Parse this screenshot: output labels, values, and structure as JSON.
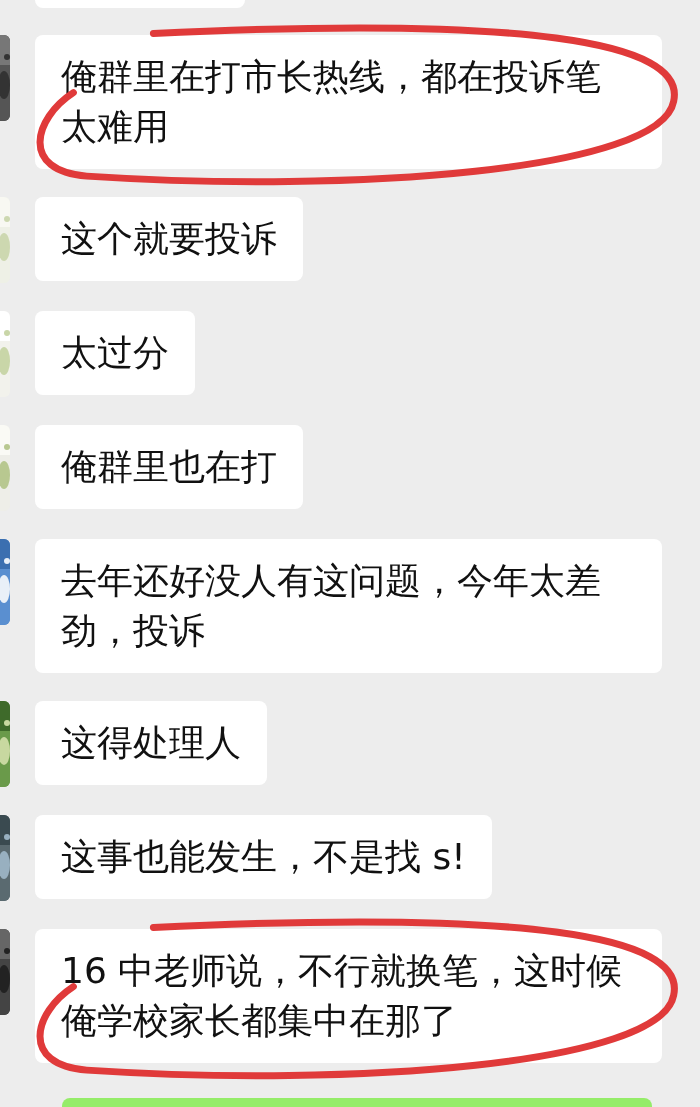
{
  "messages": [
    {
      "text": "俺群里在打市长热线，都在投诉笔太难用",
      "circled": true
    },
    {
      "text": "这个就要投诉",
      "circled": false
    },
    {
      "text": "太过分",
      "circled": false
    },
    {
      "text": "俺群里也在打",
      "circled": false
    },
    {
      "text": "去年还好没人有这问题，今年太差劲，投诉",
      "circled": false
    },
    {
      "text": "这得处理人",
      "circled": false
    },
    {
      "text": "这事也能发生，不是找 s!",
      "circled": false
    },
    {
      "text": "16 中老师说，不行就换笔，这时候俺学校家长都集中在那了",
      "circled": true
    }
  ]
}
